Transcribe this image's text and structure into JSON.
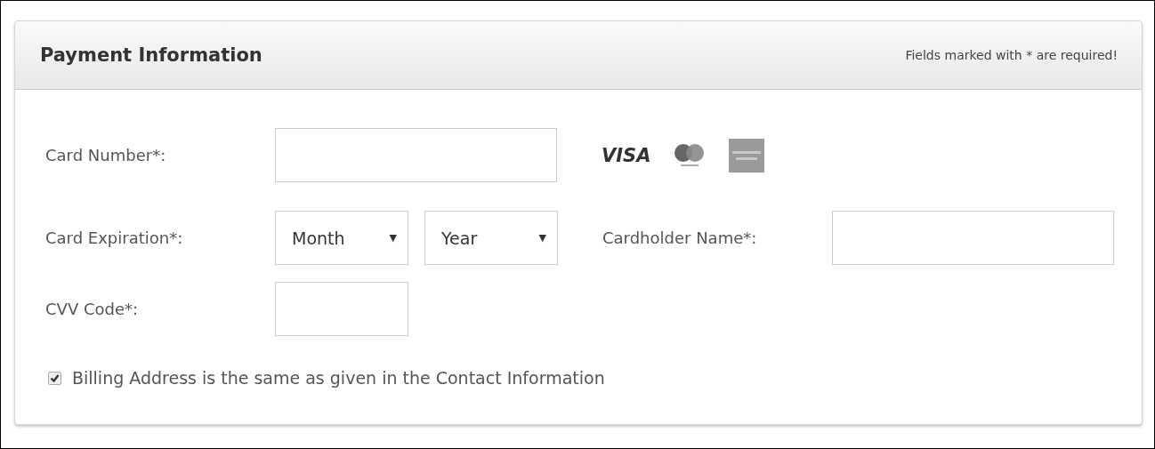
{
  "panel": {
    "title": "Payment Information",
    "note": "Fields marked with * are required!"
  },
  "card_number": {
    "label": "Card Number*:",
    "logos": [
      {
        "kind": "visa",
        "text": "VISA"
      },
      {
        "kind": "mastercard"
      },
      {
        "kind": "amex"
      }
    ]
  },
  "expiration": {
    "label": "Card Expiration*:",
    "month": {
      "value": "Month",
      "arrow": "▼"
    },
    "year": {
      "value": "Year",
      "arrow": "▼"
    }
  },
  "cardholder": {
    "label": "Cardholder Name*:"
  },
  "cvv": {
    "label": "CVV Code*:"
  },
  "billing": {
    "label": "Billing Address is the same as given in the Contact Information",
    "checked": true
  }
}
